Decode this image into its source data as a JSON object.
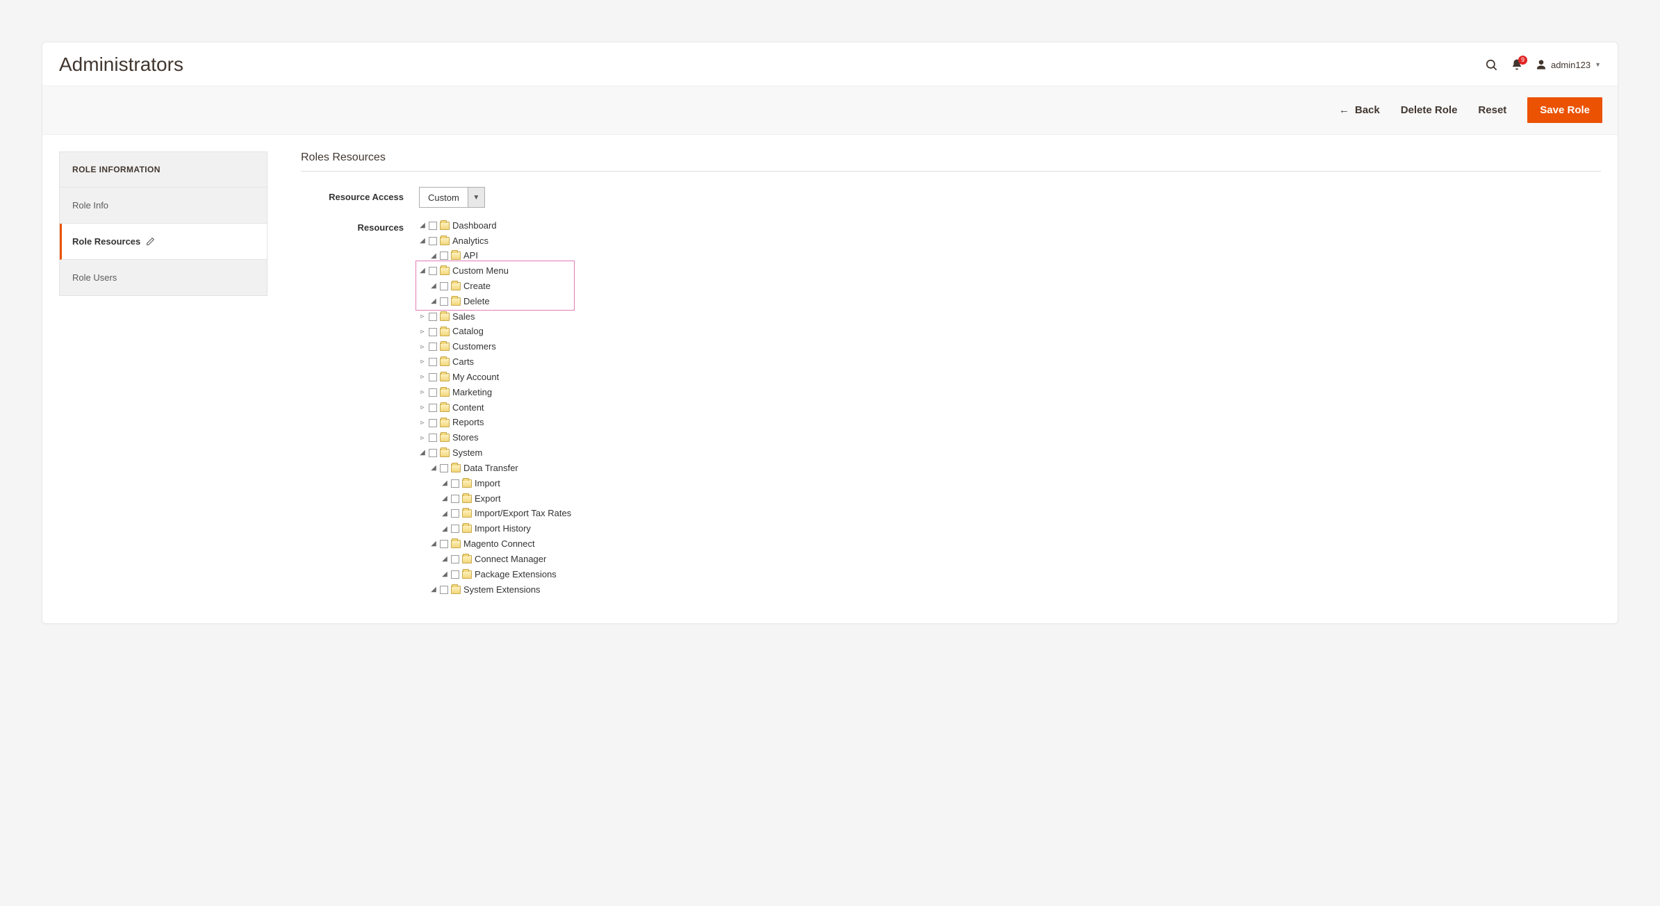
{
  "header": {
    "title": "Administrators",
    "notification_count": "9",
    "username": "admin123"
  },
  "toolbar": {
    "back": "Back",
    "delete": "Delete Role",
    "reset": "Reset",
    "save": "Save Role"
  },
  "sidebar": {
    "title": "ROLE INFORMATION",
    "items": [
      {
        "label": "Role Info",
        "active": false
      },
      {
        "label": "Role Resources",
        "active": true
      },
      {
        "label": "Role Users",
        "active": false
      }
    ]
  },
  "section": {
    "title": "Roles Resources",
    "access_label": "Resource Access",
    "access_value": "Custom",
    "resources_label": "Resources"
  },
  "tree": {
    "dashboard": "Dashboard",
    "analytics": "Analytics",
    "api": "API",
    "custom_menu": "Custom Menu",
    "create": "Create",
    "delete": "Delete",
    "sales": "Sales",
    "catalog": "Catalog",
    "customers": "Customers",
    "carts": "Carts",
    "my_account": "My Account",
    "marketing": "Marketing",
    "content": "Content",
    "reports": "Reports",
    "stores": "Stores",
    "system": "System",
    "data_transfer": "Data Transfer",
    "import": "Import",
    "export": "Export",
    "import_export_tax": "Import/Export Tax Rates",
    "import_history": "Import History",
    "magento_connect": "Magento Connect",
    "connect_manager": "Connect Manager",
    "package_extensions": "Package Extensions",
    "system_extensions": "System Extensions"
  }
}
